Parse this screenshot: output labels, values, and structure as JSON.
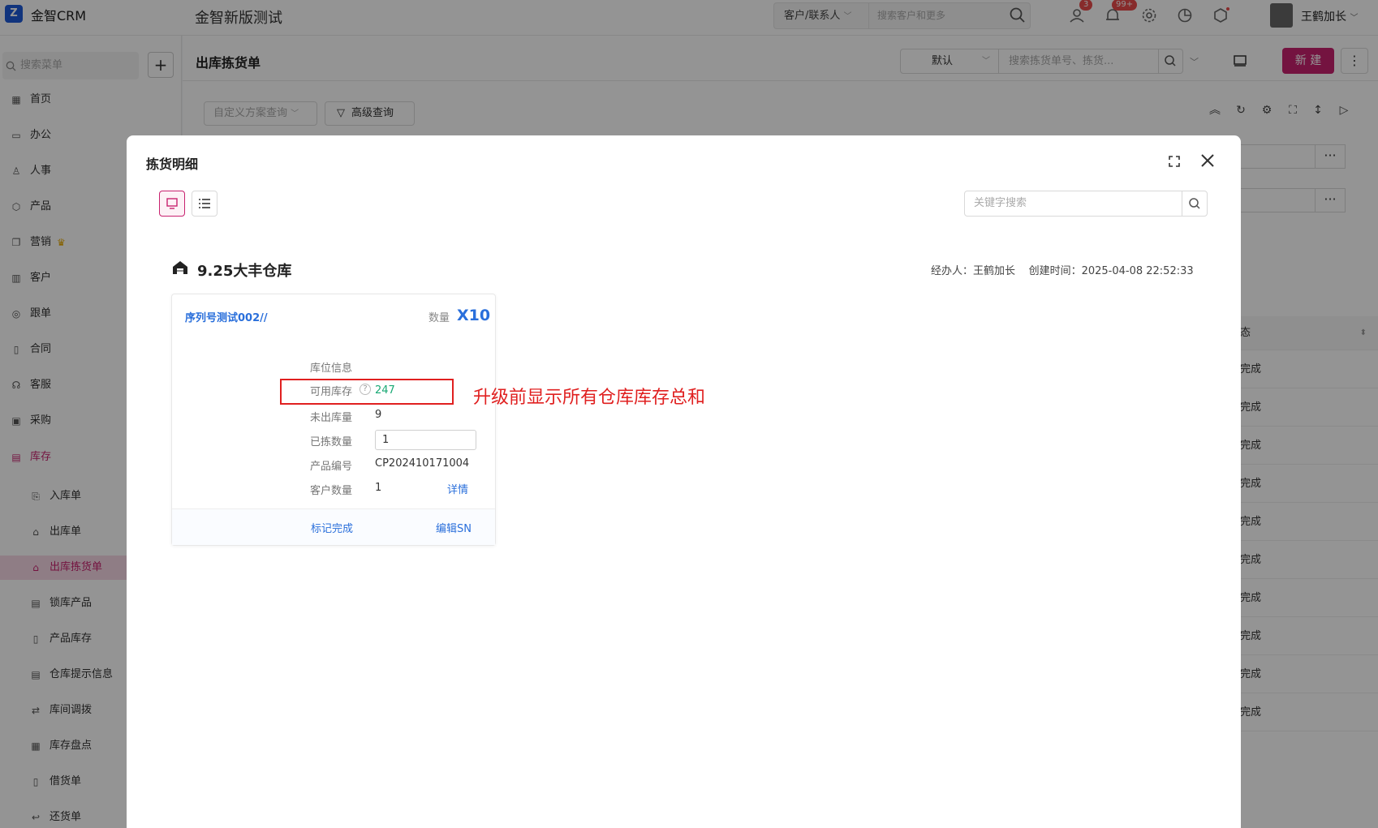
{
  "header": {
    "logo_text": "金智CRM",
    "app_title": "金智新版测试",
    "search_type": "客户/联系人",
    "search_placeholder": "搜索客户和更多",
    "message_badge": "3",
    "notification_badge": "99+",
    "user_name": "王鹤加长"
  },
  "sidebar": {
    "search_placeholder": "搜索菜单",
    "add_label": "+",
    "items": [
      {
        "label": "首页"
      },
      {
        "label": "办公"
      },
      {
        "label": "人事"
      },
      {
        "label": "产品"
      },
      {
        "label": "营销"
      },
      {
        "label": "客户"
      },
      {
        "label": "跟单"
      },
      {
        "label": "合同"
      },
      {
        "label": "客服"
      },
      {
        "label": "采购"
      },
      {
        "label": "库存"
      }
    ],
    "sub_items": [
      {
        "label": "入库单"
      },
      {
        "label": "出库单"
      },
      {
        "label": "出库拣货单"
      },
      {
        "label": "锁库产品"
      },
      {
        "label": "产品库存"
      },
      {
        "label": "仓库提示信息"
      },
      {
        "label": "库间调拨"
      },
      {
        "label": "库存盘点"
      },
      {
        "label": "借货单"
      },
      {
        "label": "还货单"
      }
    ]
  },
  "page": {
    "title": "出库拣货单",
    "view_select": "默认",
    "search_placeholder": "搜索拣货单号、拣货...",
    "new_button": "新 建",
    "filter_placeholder": "自定义方案查询",
    "advanced_query": "高级查询",
    "table_header": "态",
    "table_rows": [
      "完成",
      "完成",
      "完成",
      "完成",
      "完成",
      "完成",
      "完成",
      "完成",
      "完成",
      "完成"
    ]
  },
  "modal": {
    "title": "拣货明细",
    "keyword_placeholder": "关键字搜索",
    "warehouse_name": "9.25大丰仓库",
    "handler_label": "经办人：",
    "handler_name": "王鹤加长",
    "created_label": "创建时间：",
    "created_time": "2025-04-08 22:52:33",
    "card": {
      "product_name": "序列号测试002//",
      "qty_label": "数量",
      "qty_value": "X10",
      "location_label": "库位信息",
      "available_label": "可用库存",
      "available_value": "247",
      "unshipped_label": "未出库量",
      "unshipped_value": "9",
      "picked_label": "已拣数量",
      "picked_value": "1",
      "product_code_label": "产品编号",
      "product_code_value": "CP202410171004",
      "customer_qty_label": "客户数量",
      "customer_qty_value": "1",
      "detail_link": "详情",
      "mark_done": "标记完成",
      "edit_sn": "编辑SN"
    },
    "annotation": "升级前显示所有仓库库存总和"
  },
  "colors": {
    "brand": "#c8226f",
    "link": "#2a6fdb",
    "stock_green": "#19a974",
    "annotation_red": "#e02020"
  }
}
